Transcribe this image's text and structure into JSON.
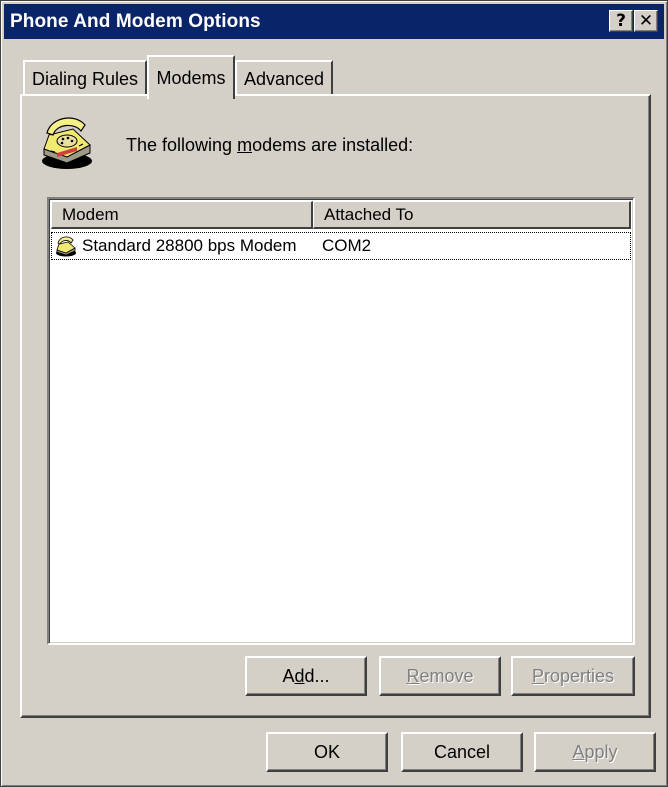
{
  "window": {
    "title": "Phone And Modem Options",
    "help_button": "?",
    "close_button": "✕"
  },
  "tabs": [
    {
      "label": "Dialing Rules",
      "active": false
    },
    {
      "label": "Modems",
      "active": true
    },
    {
      "label": "Advanced",
      "active": false
    }
  ],
  "modems_page": {
    "intro_pre": "The following ",
    "intro_mnemonic": "m",
    "intro_post": "odems are  installed:",
    "intro_icon": "telephone-icon",
    "list": {
      "columns": [
        "Modem",
        "Attached To"
      ],
      "rows": [
        {
          "icon": "modem-icon",
          "modem": "Standard 28800 bps Modem",
          "attached_to": "COM2",
          "selected": true
        }
      ]
    },
    "buttons": {
      "add_pre": "A",
      "add_mnemonic": "d",
      "add_post": "d...",
      "remove_mnemonic": "R",
      "remove_post": "emove",
      "properties_mnemonic": "P",
      "properties_post": "roperties"
    }
  },
  "footer": {
    "ok": "OK",
    "cancel": "Cancel",
    "apply_mnemonic": "A",
    "apply_post": "pply"
  },
  "colors": {
    "titlebar": "#0a246a",
    "face": "#d4d0c8",
    "disabled_text": "#808080"
  }
}
